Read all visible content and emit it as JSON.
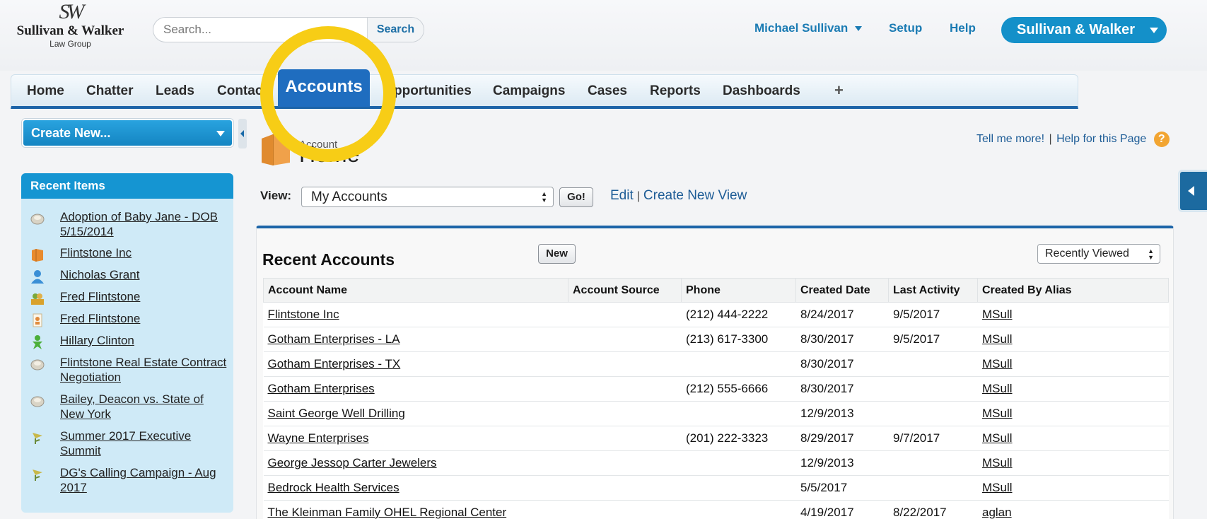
{
  "logo": {
    "monogram": "SW",
    "name": "Sullivan & Walker",
    "sub": "Law Group"
  },
  "search": {
    "placeholder": "Search...",
    "button": "Search"
  },
  "header": {
    "user": "Michael Sullivan",
    "setup": "Setup",
    "help": "Help",
    "org": "Sullivan & Walker"
  },
  "tabs": {
    "home": "Home",
    "chatter": "Chatter",
    "leads": "Leads",
    "contacts": "Contac",
    "accounts": "Accounts",
    "opportunities": "pportunities",
    "campaigns": "Campaigns",
    "cases": "Cases",
    "reports": "Reports",
    "dashboards": "Dashboards",
    "plus": "+"
  },
  "sidebar": {
    "create_new": "Create New...",
    "recent_title": "Recent Items",
    "items": [
      {
        "label": "Adoption of Baby Jane - DOB 5/15/2014",
        "icon": "case-icon"
      },
      {
        "label": "Flintstone Inc",
        "icon": "account-folder-icon"
      },
      {
        "label": "Nicholas Grant",
        "icon": "contact-person-icon"
      },
      {
        "label": "Fred Flintstone",
        "icon": "lead-icon"
      },
      {
        "label": "Fred Flintstone",
        "icon": "contact-card-icon"
      },
      {
        "label": "Hillary Clinton",
        "icon": "person-icon"
      },
      {
        "label": "Flintstone Real Estate Contract Negotiation",
        "icon": "case-icon"
      },
      {
        "label": "Bailey, Deacon vs. State of New York",
        "icon": "case-icon"
      },
      {
        "label": "Summer 2017 Executive Summit",
        "icon": "campaign-icon"
      },
      {
        "label": "DG's Calling Campaign - Aug 2017",
        "icon": "campaign-icon"
      }
    ]
  },
  "main": {
    "help_more": "Tell me more!",
    "help_sep": "|",
    "help_page": "Help for this Page",
    "help_icon": "?",
    "title_small": "Account",
    "title": "Home",
    "view_label": "View:",
    "view_value": "My Accounts",
    "go": "Go!",
    "edit": "Edit",
    "view_sep": "|",
    "create_view": "Create New View"
  },
  "recent_accounts": {
    "title": "Recent Accounts",
    "new": "New",
    "sort": "Recently Viewed",
    "columns": [
      "Account Name",
      "Account Source",
      "Phone",
      "Created Date",
      "Last Activity",
      "Created By Alias"
    ],
    "rows": [
      [
        "Flintstone Inc",
        "",
        "(212) 444-2222",
        "8/24/2017",
        "9/5/2017",
        "MSull"
      ],
      [
        "Gotham Enterprises - LA",
        "",
        "(213) 617-3300",
        "8/30/2017",
        "9/5/2017",
        "MSull"
      ],
      [
        "Gotham Enterprises - TX",
        "",
        "",
        "8/30/2017",
        "",
        "MSull"
      ],
      [
        "Gotham Enterprises",
        "",
        "(212) 555-6666",
        "8/30/2017",
        "",
        "MSull"
      ],
      [
        "Saint George Well Drilling",
        "",
        "",
        "12/9/2013",
        "",
        "MSull"
      ],
      [
        "Wayne Enterprises",
        "",
        "(201) 222-3323",
        "8/29/2017",
        "9/7/2017",
        "MSull"
      ],
      [
        "George Jessop Carter Jewelers",
        "",
        "",
        "12/9/2013",
        "",
        "MSull"
      ],
      [
        "Bedrock Health Services",
        "",
        "",
        "5/5/2017",
        "",
        "MSull"
      ],
      [
        "The Kleinman Family OHEL Regional Center",
        "",
        "",
        "4/19/2017",
        "8/22/2017",
        "aglan"
      ]
    ]
  },
  "colors": {
    "accent": "#1595d2",
    "tab_active": "#1f6dbf",
    "highlight": "#f7cd16",
    "link": "#1d5c96"
  }
}
